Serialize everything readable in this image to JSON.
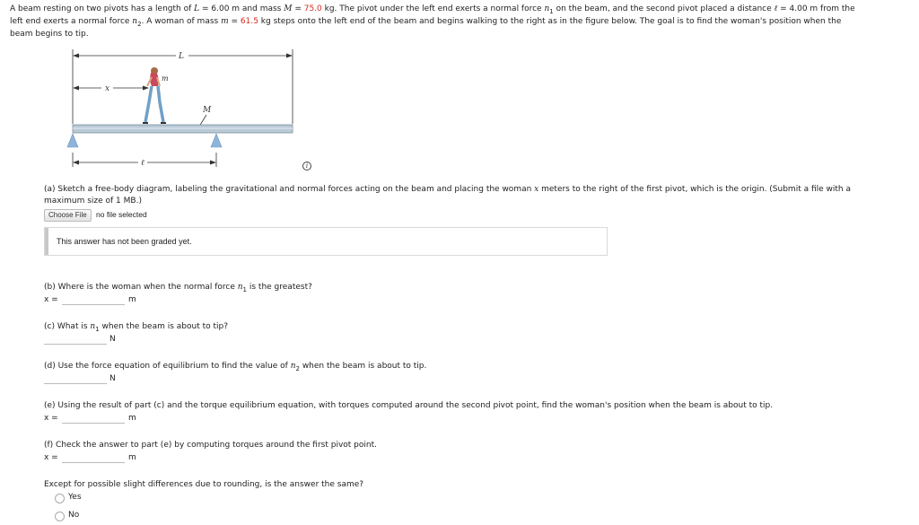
{
  "problem": {
    "l1_a": "A beam resting on two pivots has a length of ",
    "L_sym": "L",
    "l1_b": " = 6.00 m and mass ",
    "M_sym": "M",
    "l1_c": " = ",
    "mass_beam": "75.0",
    "l1_d": " kg. The pivot under the left end exerts a normal force ",
    "n_sym": "n",
    "sub1": "1",
    "l1_e": " on the beam, and the second pivot placed a distance ",
    "ell_sym": "ℓ",
    "l1_f": " = 4.00 m from the",
    "l2_a": "left end exerts a normal force ",
    "sub2": "2",
    "l2_b": ". A woman of mass ",
    "m_sym": "m",
    "l2_c": " = ",
    "mass_woman": "61.5",
    "l2_d": " kg steps onto the left end of the beam and begins walking to the right as in the figure below. The goal is to find the woman's position when the",
    "l3": "beam begins to tip."
  },
  "figure": {
    "label_L": "L",
    "label_x": "x",
    "label_m": "m",
    "label_M": "M",
    "label_ell": "ℓ",
    "info_icon": "info-icon"
  },
  "part_a": {
    "line1_a": "(a) Sketch a free-body diagram, labeling the gravitational and normal forces acting on the beam and placing the woman ",
    "x_sym": "x",
    "line1_b": " meters to the right of the first pivot, which is the origin. (Submit a file with a",
    "line2": "maximum size of 1 MB.)",
    "choose_file": "Choose File",
    "no_file": "no file selected",
    "graded": "This answer has not been graded yet."
  },
  "part_b": {
    "q_a": "(b) Where is the woman when the normal force ",
    "q_b": " is the greatest?",
    "x_label": "x =",
    "unit": "m"
  },
  "part_c": {
    "q_a": "(c) What is ",
    "q_b": " when the beam is about to tip?",
    "unit": "N"
  },
  "part_d": {
    "q_a": "(d) Use the force equation of equilibrium to find the value of ",
    "q_b": " when the beam is about to tip.",
    "unit": "N"
  },
  "part_e": {
    "q": "(e) Using the result of part (c) and the torque equilibrium equation, with torques computed around the second pivot point, find the woman's position when the beam is about to tip.",
    "x_label": "x =",
    "unit": "m"
  },
  "part_f": {
    "q": "(f) Check the answer to part (e) by computing torques around the first pivot point.",
    "x_label": "x =",
    "unit": "m"
  },
  "part_g": {
    "q": "Except for possible slight differences due to rounding, is the answer the same?",
    "options": [
      "Yes",
      "No"
    ]
  },
  "colors": {
    "accent_red": "#d62a1e",
    "pivot_blue": "#8fb4dc",
    "beam": "#b9c9d6"
  }
}
